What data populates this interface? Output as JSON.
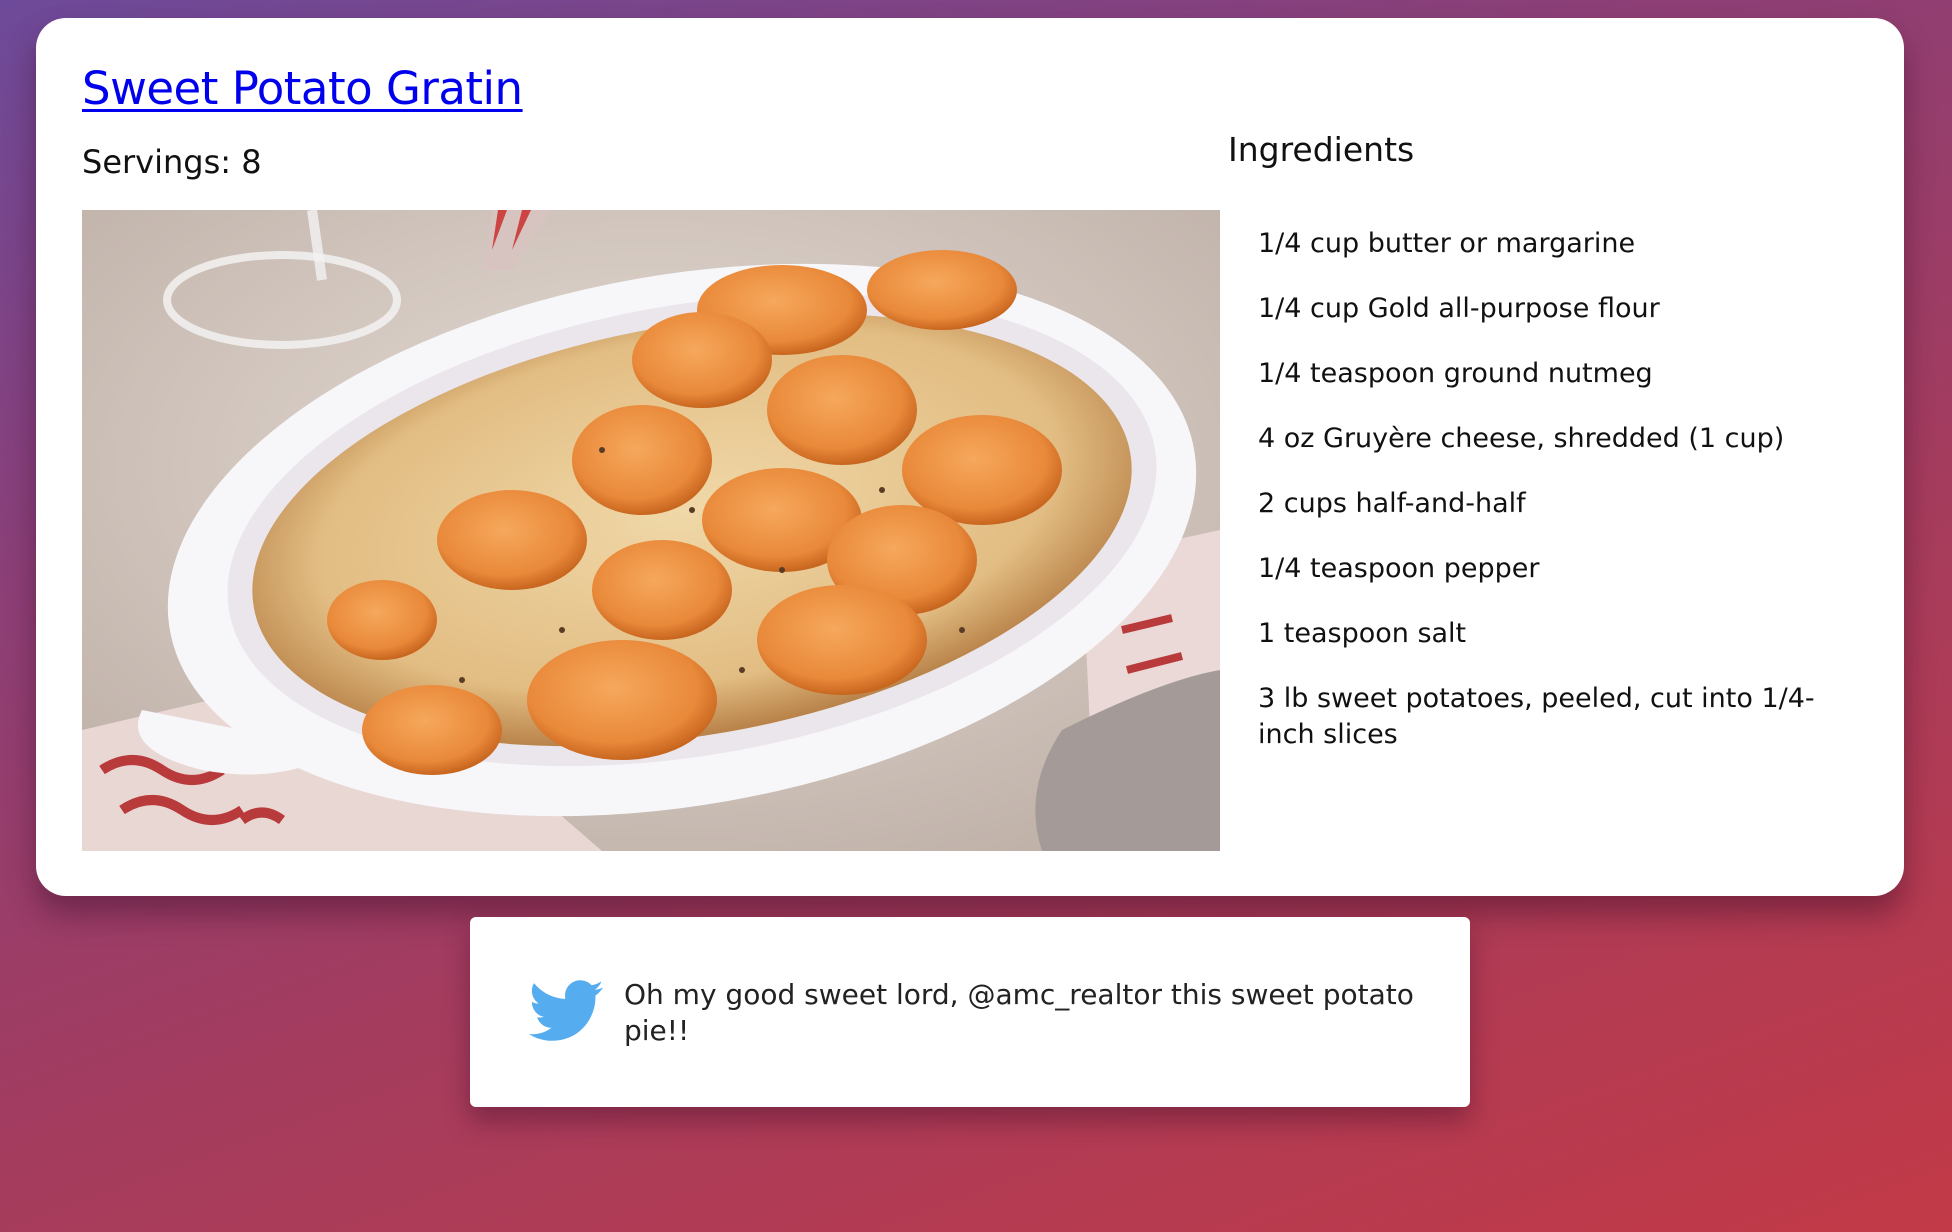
{
  "recipe": {
    "title": "Sweet Potato Gratin",
    "servings_text": "Servings: 8",
    "image_alt": "Sweet potato gratin in an oval baking dish",
    "ingredients_heading": "Ingredients",
    "ingredients": [
      "1/4 cup butter or margarine",
      "1/4 cup Gold all-purpose flour",
      "1/4 teaspoon ground nutmeg",
      "4 oz Gruyère cheese, shredded (1 cup)",
      "2 cups half-and-half",
      "1/4 teaspoon pepper",
      "1 teaspoon salt",
      "3 lb sweet potatoes, peeled, cut into 1/4-inch slices"
    ]
  },
  "tweet": {
    "icon": "twitter-bird-icon",
    "text": "Oh my good sweet lord, @amc_realtor this sweet potato pie!!"
  },
  "colors": {
    "link": "#0000ee",
    "twitter_blue": "#55acee",
    "background_start": "#6d4a9a",
    "background_end": "#c23a47"
  }
}
